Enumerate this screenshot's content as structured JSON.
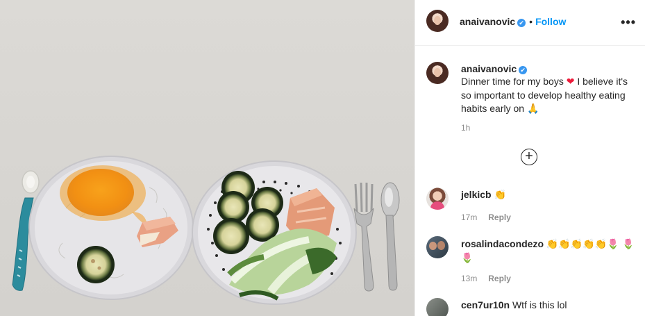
{
  "post": {
    "username": "anaivanovic",
    "verified_mark": "✔",
    "follow_label": "Follow",
    "separator": "•",
    "more_icon": "•••"
  },
  "caption": {
    "username": "anaivanovic",
    "text_before_heart": "Dinner time for my boys",
    "heart": "❤",
    "text_after_heart": "I believe it's so important to develop healthy eating habits early on",
    "pray": "🙏",
    "time": "1h"
  },
  "load_more_icon": "+",
  "comments": [
    {
      "username": "jelkicb",
      "text": "👏",
      "time": "17m",
      "reply": "Reply"
    },
    {
      "username": "rosalindacondezo",
      "text": "👏👏👏👏👏🌷 🌷🌷",
      "time": "13m",
      "reply": "Reply"
    },
    {
      "username": "cen7ur10n",
      "text": "Wtf is this lol"
    }
  ],
  "colors": {
    "accent": "#0095f6",
    "verified": "#3897f0",
    "secondary_text": "#8e8e8e"
  }
}
